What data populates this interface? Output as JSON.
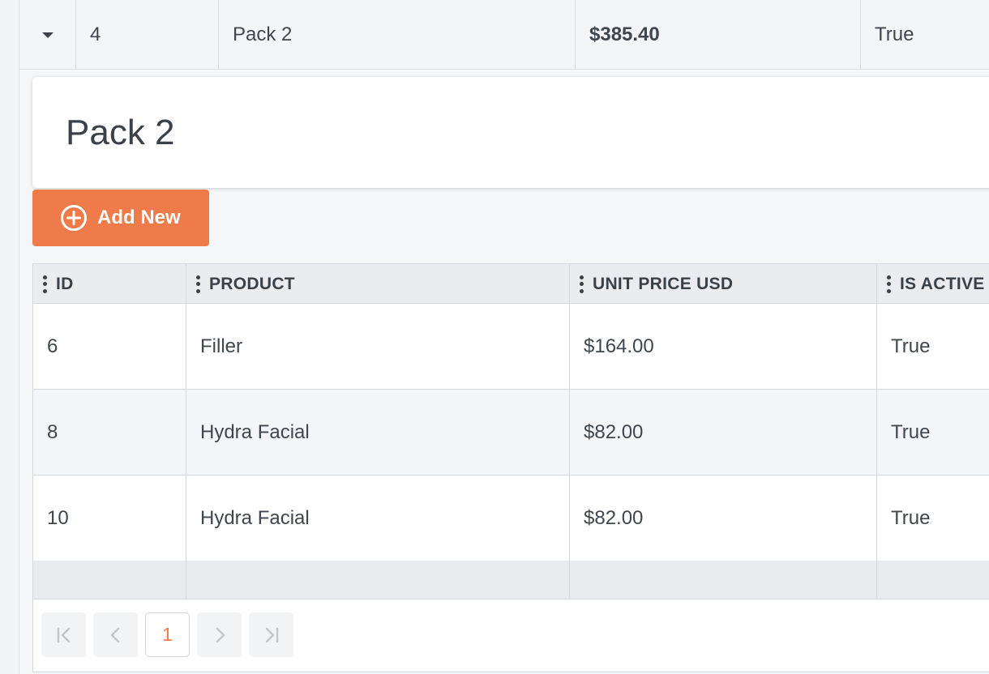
{
  "master_row": {
    "id": "4",
    "name": "Pack 2",
    "price": "$385.40",
    "active": "True"
  },
  "detail": {
    "title": "Pack 2",
    "add_button_label": "Add New"
  },
  "grid": {
    "columns": [
      "ID",
      "PRODUCT",
      "UNIT PRICE USD",
      "IS ACTIVE"
    ],
    "rows": [
      {
        "id": "6",
        "product": "Filler",
        "price": "$164.00",
        "active": "True"
      },
      {
        "id": "8",
        "product": "Hydra Facial",
        "price": "$82.00",
        "active": "True"
      },
      {
        "id": "10",
        "product": "Hydra Facial",
        "price": "$82.00",
        "active": "True"
      }
    ]
  },
  "pager": {
    "current_page": "1"
  },
  "colors": {
    "accent": "#ef7b4b",
    "header_bg": "#eaecef",
    "alt_row_bg": "#f4f5f8"
  }
}
